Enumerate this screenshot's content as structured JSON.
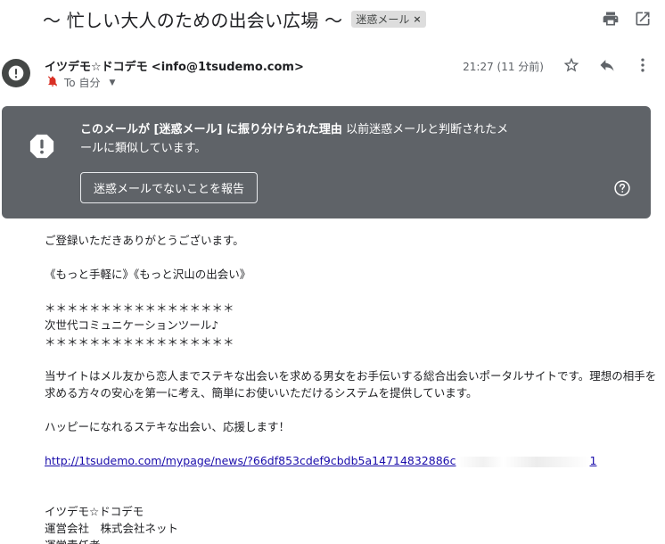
{
  "subject": {
    "title": "〜 忙しい大人のための出会い広場 〜",
    "label": "迷惑メール",
    "label_remove": "×"
  },
  "top_icons": [
    "print-icon",
    "open-in-new-window-icon"
  ],
  "sender": {
    "name": "イツデモ☆ドコデモ",
    "email": "<info@1tsudemo.com>",
    "to_label": "To 自分",
    "timestamp": "21:27 (11 分前)"
  },
  "header_actions": [
    "star-icon",
    "reply-icon",
    "more-vertical-icon"
  ],
  "spam_banner": {
    "reason_bold": "このメールが [迷惑メール] に振り分けられた理由",
    "reason_text": " 以前迷惑メールと判断されたメールに類似しています。",
    "not_spam_button": "迷惑メールでないことを報告",
    "colors": {
      "background": "#5f6368",
      "text": "#ffffff"
    }
  },
  "body": {
    "greeting": "ご登録いただきありがとうございます。",
    "tagline": "《もっと手軽に》《もっと沢山の出会い》",
    "stars": "＊＊＊＊＊＊＊＊＊＊＊＊＊＊＊＊＊",
    "tool_line": "次世代コミュニケーションツール♪",
    "description": "当サイトはメル友から恋人までステキな出会いを求める男女をお手伝いする総合出会いポータルサイトです。理想の相手を求める方々の安心を第一に考え、簡単にお使いいただけるシステムを提供しています。",
    "cheer": "ハッピーになれるステキな出会い、応援します！",
    "link": "http://1tsudemo.com/mypage/news/?66df853cdef9cbdb5a14714832886c",
    "link_tail": "1",
    "signature_name": "イツデモ☆ドコデモ",
    "company": "運営会社　株式会社ネット",
    "manager": "運営責任者"
  }
}
